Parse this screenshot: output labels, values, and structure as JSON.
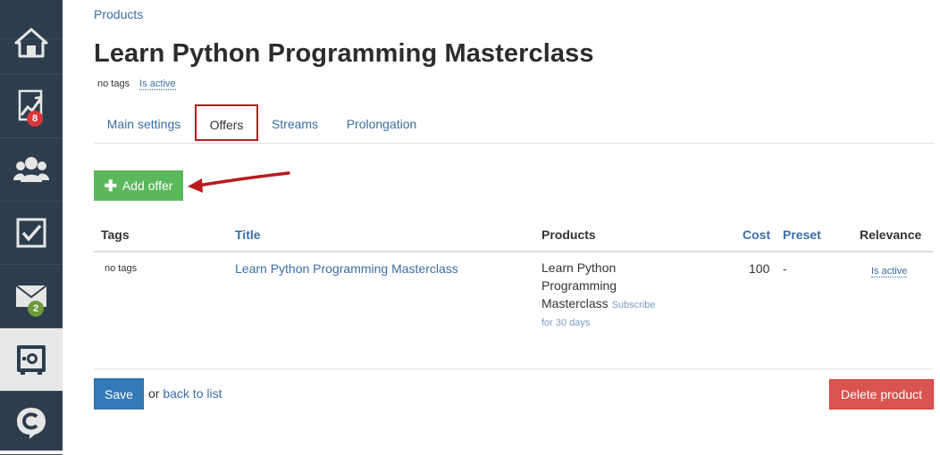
{
  "sidebar": {
    "items": [
      {
        "icon": "home-icon"
      },
      {
        "icon": "chart-trend-icon",
        "badge": "8",
        "badge_color": "#d9383a"
      },
      {
        "icon": "users-icon"
      },
      {
        "icon": "checkbox-icon"
      },
      {
        "icon": "mail-icon",
        "badge": "2",
        "badge_color": "#6b9a3a"
      },
      {
        "icon": "safe-icon",
        "active": true
      },
      {
        "icon": "chat-c-icon"
      }
    ]
  },
  "breadcrumb": "Products",
  "page": {
    "title": "Learn Python Programming Masterclass",
    "tags": "no tags",
    "status_link": "Is active"
  },
  "tabs": [
    {
      "label": "Main settings"
    },
    {
      "label": "Offers",
      "active": true
    },
    {
      "label": "Streams"
    },
    {
      "label": "Prolongation"
    }
  ],
  "add_offer_button": {
    "icon": "plus-icon",
    "label": "Add offer",
    "color": "#5cb85c"
  },
  "annotation": {
    "arrow_color": "#b81c1c",
    "highlight_color": "#b81c1c"
  },
  "table": {
    "headers": {
      "tags": "Tags",
      "title": "Title",
      "products": "Products",
      "cost": "Cost",
      "preset": "Preset",
      "relevance": "Relevance"
    },
    "rows": [
      {
        "tags": "no tags",
        "title": "Learn Python Programming Masterclass",
        "product_line1": "Learn Python",
        "product_line2": "Programming",
        "product_line3": "Masterclass",
        "product_sub1": "Subscribe",
        "product_sub2": "for 30 days",
        "cost": "100",
        "preset": "-",
        "relevance": "Is active"
      }
    ]
  },
  "footer": {
    "save_label": "Save",
    "or_text": "or",
    "back_label": "back to list",
    "delete_label": "Delete product"
  },
  "colors": {
    "sidebar_bg": "#2e3d4d",
    "link": "#3a6ea5",
    "save": "#337ab7",
    "delete": "#d9534f"
  }
}
